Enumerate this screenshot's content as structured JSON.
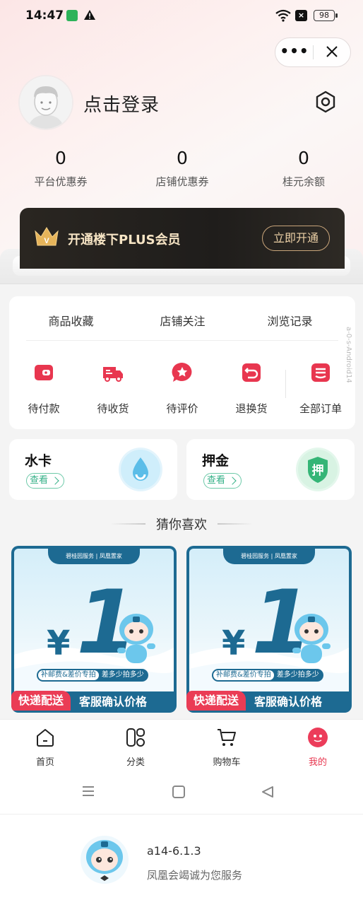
{
  "status_bar": {
    "time": "14:47",
    "battery": "98"
  },
  "capsule": {
    "more": "•••"
  },
  "profile": {
    "login_text": "点击登录"
  },
  "stats": [
    {
      "value": "0",
      "label": "平台优惠券"
    },
    {
      "value": "0",
      "label": "店铺优惠券"
    },
    {
      "value": "0",
      "label": "桂元余额"
    }
  ],
  "plus": {
    "title": "开通楼下PLUS会员",
    "button": "立即开通",
    "crown_letter": "V"
  },
  "quick_links": [
    "商品收藏",
    "店铺关注",
    "浏览记录"
  ],
  "orders": [
    {
      "label": "待付款",
      "icon": "wallet-icon"
    },
    {
      "label": "待收货",
      "icon": "truck-icon"
    },
    {
      "label": "待评价",
      "icon": "review-icon"
    },
    {
      "label": "退换货",
      "icon": "return-icon"
    },
    {
      "label": "全部订单",
      "icon": "orders-icon"
    }
  ],
  "water_card": {
    "title": "水卡",
    "view": "查看",
    "icon": "water-drop-icon"
  },
  "deposit_card": {
    "title": "押金",
    "view": "查看",
    "icon_text": "押"
  },
  "guess": {
    "title": "猜你喜欢"
  },
  "products": [
    {
      "brand": "碧桂园服务 | 凤凰置家",
      "yen": "¥",
      "price": "1",
      "tag_left": "补邮费&差价专拍",
      "tag_right": "差多少拍多少",
      "confirm": "客服确认价格",
      "badge": "快递配送"
    },
    {
      "brand": "碧桂园服务 | 凤凰置家",
      "yen": "¥",
      "price": "1",
      "tag_left": "补邮费&差价专拍",
      "tag_right": "差多少拍多少",
      "confirm": "客服确认价格",
      "badge": "快递配送"
    }
  ],
  "tabs": [
    {
      "label": "首页",
      "active": false
    },
    {
      "label": "分类",
      "active": false
    },
    {
      "label": "购物车",
      "active": false
    },
    {
      "label": "我的",
      "active": true
    }
  ],
  "footer": {
    "version": "a14-6.1.3",
    "service": "凤凰会竭诚为您服务"
  },
  "watermark": "a-0-s-Android14",
  "colors": {
    "accent": "#e8364f",
    "green": "#35b087",
    "brand_blue": "#1d6a92",
    "gold": "#ecd0a6"
  }
}
